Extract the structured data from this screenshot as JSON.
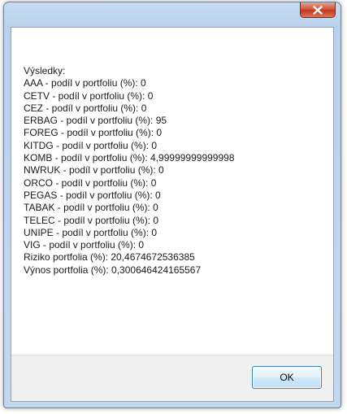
{
  "window": {
    "title": "",
    "close_icon": "close-x-icon"
  },
  "results": {
    "heading": "Výsledky:",
    "lines": [
      "AAA - podíl v portfoliu (%): 0",
      "CETV - podíl v portfoliu (%): 0",
      "CEZ - podíl v portfoliu (%): 0",
      "ERBAG - podíl v portfoliu (%): 95",
      "FOREG - podíl v portfoliu (%): 0",
      "KITDG - podíl v portfoliu (%): 0",
      "KOMB - podíl v portfoliu (%): 4,99999999999998",
      "NWRUK - podíl v portfoliu (%): 0",
      "ORCO - podíl v portfoliu (%): 0",
      "PEGAS - podíl v portfoliu (%): 0",
      "TABAK - podíl v portfoliu (%): 0",
      "TELEC - podíl v portfoliu (%): 0",
      "UNIPE - podíl v portfoliu (%): 0",
      "VIG - podíl v portfoliu (%): 0",
      "Riziko portfolia (%): 20,4674672536385",
      "Výnos portfolia (%): 0,300646424165567"
    ]
  },
  "buttons": {
    "ok_label": "OK"
  },
  "colors": {
    "frame": "#c4d8ef",
    "close_button": "#c8442a",
    "ok_border": "#3c7fb1",
    "panel": "#f0f0f0"
  }
}
